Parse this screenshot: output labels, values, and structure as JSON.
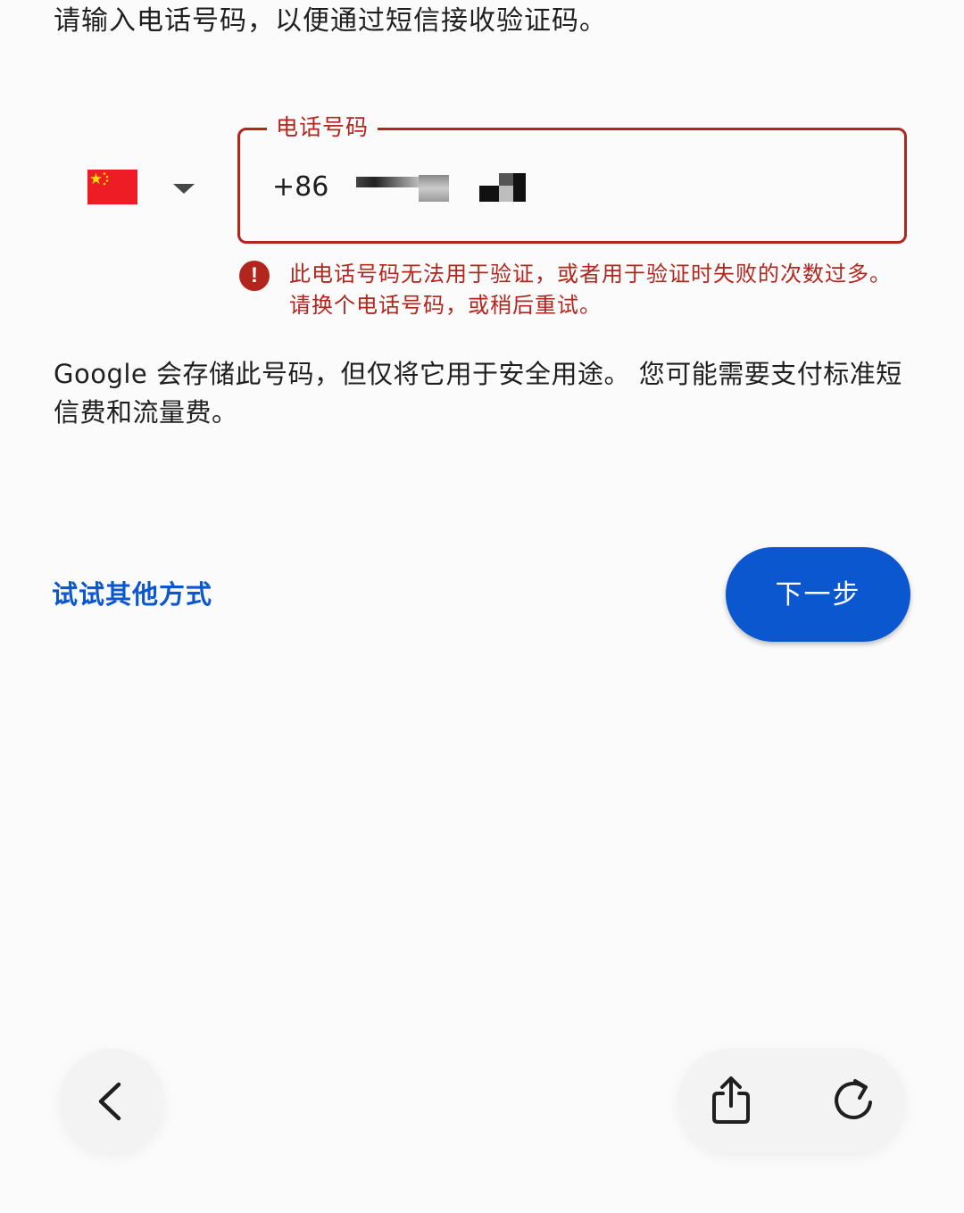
{
  "page": {
    "instruction": "请输入电话号码，以便通过短信接收验证码。",
    "notice": "Google 会存储此号码，但仅将它用于安全用途。 您可能需要支付标准短信费和流量费。"
  },
  "country_selector": {
    "flag": "china-flag-icon",
    "dropdown": "dropdown-arrow-icon"
  },
  "phone_field": {
    "label": "电话号码",
    "value": "+86"
  },
  "error": {
    "icon": "error-icon",
    "icon_glyph": "!",
    "message": "此电话号码无法用于验证，或者用于验证时失败的次数过多。请换个电话号码，或稍后重试。"
  },
  "actions": {
    "try_other": "试试其他方式",
    "next": "下一步"
  },
  "browser_controls": {
    "back": "back-icon",
    "share": "share-icon",
    "reload": "reload-icon"
  },
  "colors": {
    "error": "#b3261e",
    "primary": "#0b57d0",
    "text": "#1f1f1f"
  }
}
